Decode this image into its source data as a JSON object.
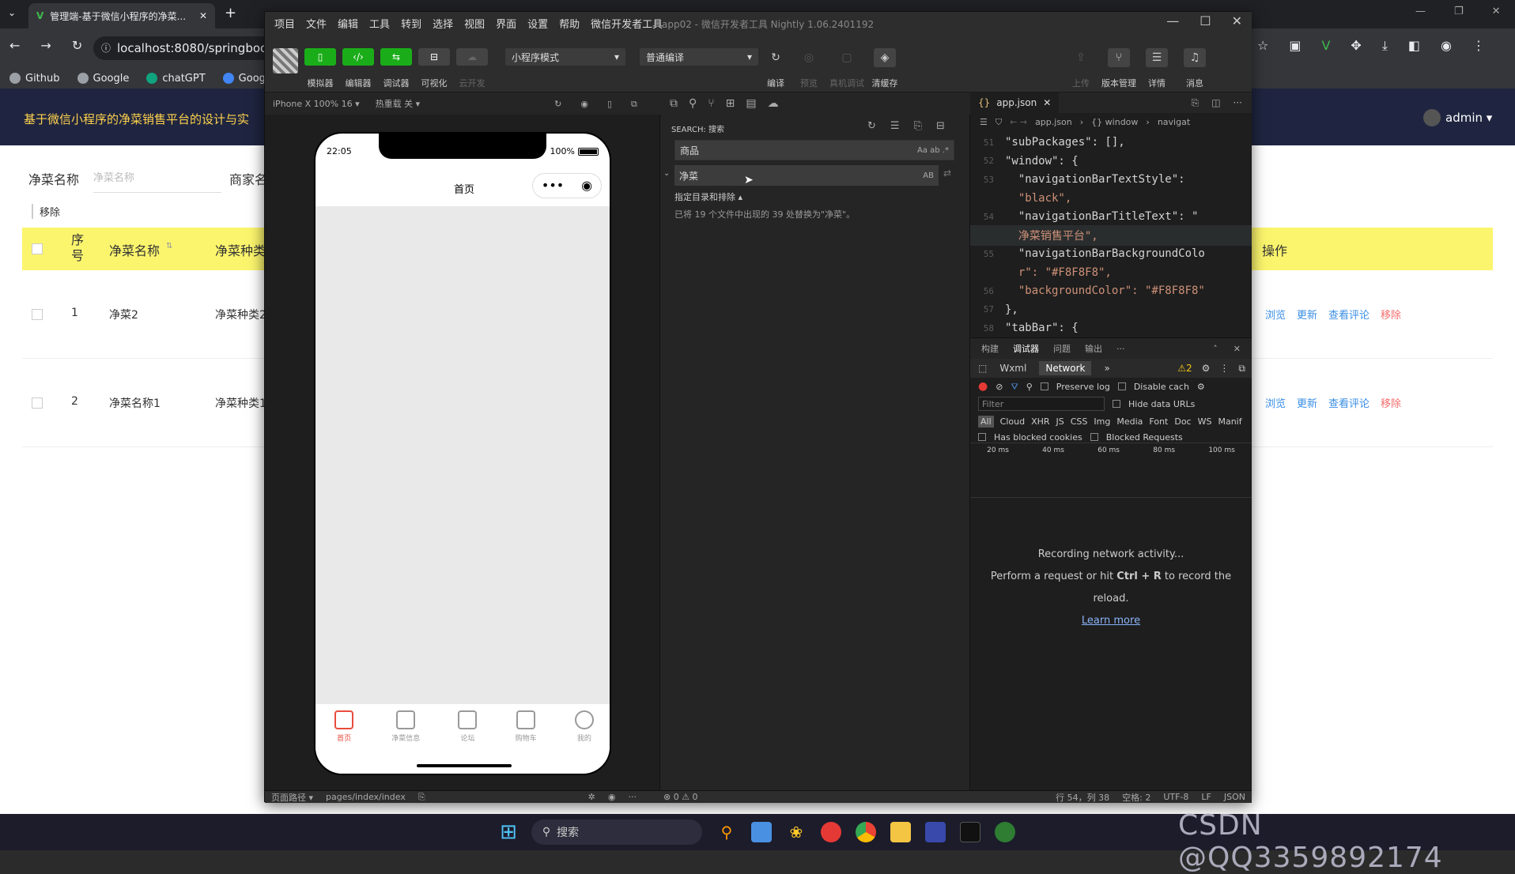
{
  "browser": {
    "tab_title": "管理端-基于微信小程序的净菜...",
    "url": "localhost:8080/springboot",
    "bookmarks": [
      "Github",
      "Google",
      "chatGPT",
      "Google"
    ]
  },
  "web": {
    "title": "基于微信小程序的净菜销售平台的设计与实",
    "admin_label": "admin ▾",
    "filter_label": "净菜名称",
    "filter_placeholder": "净菜名称",
    "filter_label2": "商家名",
    "remove_label": "移除",
    "columns": [
      "序号",
      "净菜名称",
      "净菜种类",
      "操作"
    ],
    "rows": [
      {
        "index": "1",
        "name": "净菜2",
        "type": "净菜种类2"
      },
      {
        "index": "2",
        "name": "净菜名称1",
        "type": "净菜种类1"
      }
    ],
    "ops": [
      "浏览",
      "更新",
      "查看评论",
      "移除"
    ]
  },
  "devtools": {
    "menu": [
      "项目",
      "文件",
      "编辑",
      "工具",
      "转到",
      "选择",
      "视图",
      "界面",
      "设置",
      "帮助",
      "微信开发者工具"
    ],
    "window_title": "app02 - 微信开发者工具 Nightly 1.06.2401192",
    "toolbar_left": [
      "模拟器",
      "编辑器",
      "调试器",
      "可视化",
      "云开发"
    ],
    "mode_select": "小程序模式",
    "compile_select": "普通编译",
    "toolbar_mid": [
      "编译",
      "预览",
      "真机调试",
      "清缓存"
    ],
    "toolbar_right": [
      "上传",
      "版本管理",
      "详情",
      "消息"
    ],
    "device_label": "iPhone X 100% 16 ▾",
    "hotreload_label": "热重载 关 ▾",
    "phone": {
      "time": "22:05",
      "battery": "100%",
      "battery_level": 1.0,
      "nav_title": "首页",
      "tabs": [
        "首页",
        "净菜信息",
        "论坛",
        "购物车",
        "我的"
      ]
    },
    "search": {
      "title": "SEARCH: 搜索",
      "query": "商品",
      "replace": "净菜",
      "include_label": "指定目录和排除 ▴",
      "result": "已将 19 个文件中出现的 39 处替换为\"净菜\"。"
    },
    "editor": {
      "tab": "app.json",
      "breadcrumb": [
        "app.json",
        "{} window",
        "navigat"
      ],
      "lines": [
        {
          "n": "51",
          "text": "\"subPackages\": [],"
        },
        {
          "n": "52",
          "text": "\"window\": {"
        },
        {
          "n": "53",
          "text": "  \"navigationBarTextStyle\":"
        },
        {
          "n": "",
          "text": "  \"black\","
        },
        {
          "n": "54",
          "text": "  \"navigationBarTitleText\": \""
        },
        {
          "n": "",
          "text": "  净菜销售平台\","
        },
        {
          "n": "55",
          "text": "  \"navigationBarBackgroundColo"
        },
        {
          "n": "",
          "text": "  r\": \"#F8F8F8\","
        },
        {
          "n": "56",
          "text": "  \"backgroundColor\": \"#F8F8F8\""
        },
        {
          "n": "57",
          "text": "},"
        },
        {
          "n": "58",
          "text": "\"tabBar\": {"
        }
      ]
    },
    "debug": {
      "tabs": [
        "构建",
        "调试器",
        "问题",
        "输出",
        "···"
      ],
      "panel_tabs": [
        "Wxml",
        "Network",
        "»"
      ],
      "warnings": "2",
      "preserve_log": "Preserve log",
      "disable_cache": "Disable cach",
      "filter_placeholder": "Filter",
      "hide_data_urls": "Hide data URLs",
      "types": [
        "All",
        "Cloud",
        "XHR",
        "JS",
        "CSS",
        "Img",
        "Media",
        "Font",
        "Doc",
        "WS",
        "Manif"
      ],
      "blocked_cookies": "Has blocked cookies",
      "blocked_requests": "Blocked Requests",
      "timeline": [
        "20 ms",
        "40 ms",
        "60 ms",
        "80 ms",
        "100 ms"
      ],
      "msg1": "Recording network activity...",
      "msg2a": "Perform a request or hit ",
      "msg2b": "Ctrl + R",
      "msg2c": " to record the",
      "msg3": "reload.",
      "learn_more": "Learn more"
    },
    "status": {
      "path_label": "页面路径 ▾",
      "path": "pages/index/index",
      "errors": "⊗ 0 ⚠ 0",
      "cursor": "行 54，列 38",
      "spaces": "空格: 2",
      "encoding": "UTF-8",
      "eol": "LF",
      "lang": "JSON"
    }
  },
  "taskbar": {
    "search": "搜索"
  },
  "watermark": "CSDN @QQ3359892174"
}
